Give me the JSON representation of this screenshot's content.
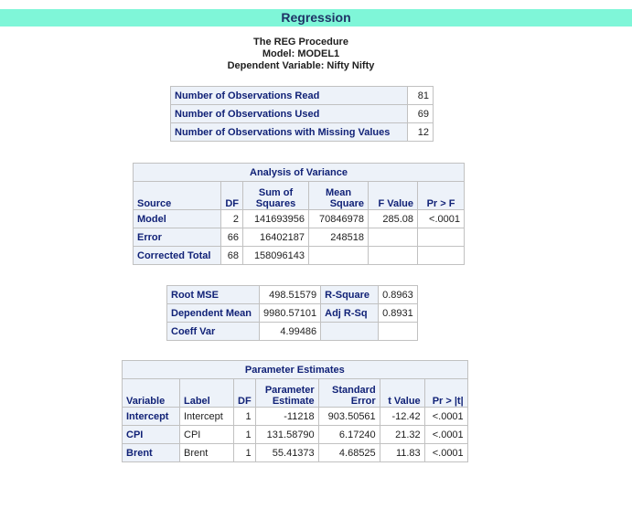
{
  "title": "Regression",
  "proc": {
    "line1": "The REG Procedure",
    "line2": "Model: MODEL1",
    "line3": "Dependent Variable: Nifty Nifty"
  },
  "obs": [
    {
      "label": "Number of Observations Read",
      "value": "81"
    },
    {
      "label": "Number of Observations Used",
      "value": "69"
    },
    {
      "label": "Number of Observations with Missing Values",
      "value": "12"
    }
  ],
  "anova": {
    "caption": "Analysis of Variance",
    "headers": {
      "source": "Source",
      "df": "DF",
      "ss1": "Sum of",
      "ss2": "Squares",
      "ms1": "Mean",
      "ms2": "Square",
      "f": "F Value",
      "p": "Pr > F"
    },
    "rows": [
      {
        "source": "Model",
        "df": "2",
        "ss": "141693956",
        "ms": "70846978",
        "f": "285.08",
        "p": "<.0001"
      },
      {
        "source": "Error",
        "df": "66",
        "ss": "16402187",
        "ms": "248518",
        "f": "",
        "p": ""
      },
      {
        "source": "Corrected Total",
        "df": "68",
        "ss": "158096143",
        "ms": "",
        "f": "",
        "p": ""
      }
    ]
  },
  "fit": [
    {
      "l1": "Root MSE",
      "v1": "498.51579",
      "l2": "R-Square",
      "v2": "0.8963"
    },
    {
      "l1": "Dependent Mean",
      "v1": "9980.57101",
      "l2": "Adj R-Sq",
      "v2": "0.8931"
    },
    {
      "l1": "Coeff Var",
      "v1": "4.99486",
      "l2": "",
      "v2": ""
    }
  ],
  "params": {
    "caption": "Parameter Estimates",
    "headers": {
      "variable": "Variable",
      "label": "Label",
      "df": "DF",
      "pe1": "Parameter",
      "pe2": "Estimate",
      "se1": "Standard",
      "se2": "Error",
      "t": "t Value",
      "p": "Pr > |t|"
    },
    "rows": [
      {
        "variable": "Intercept",
        "label": "Intercept",
        "df": "1",
        "est": "-11218",
        "se": "903.50561",
        "t": "-12.42",
        "p": "<.0001"
      },
      {
        "variable": "CPI",
        "label": "CPI",
        "df": "1",
        "est": "131.58790",
        "se": "6.17240",
        "t": "21.32",
        "p": "<.0001"
      },
      {
        "variable": "Brent",
        "label": "Brent",
        "df": "1",
        "est": "55.41373",
        "se": "4.68525",
        "t": "11.83",
        "p": "<.0001"
      }
    ]
  }
}
